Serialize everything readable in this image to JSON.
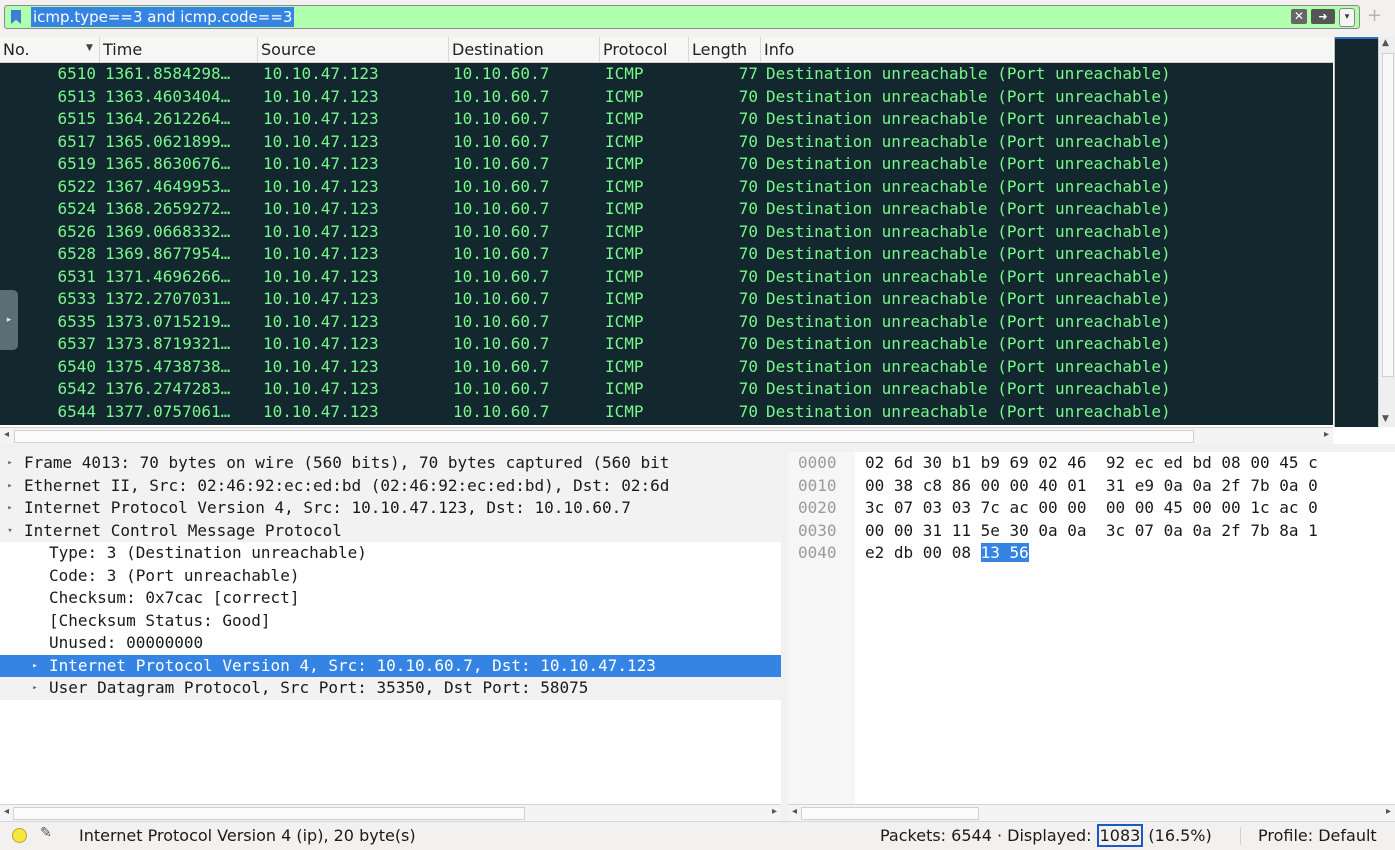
{
  "filter": {
    "expression": "icmp.type==3 and icmp.code==3",
    "clear_icon": "clear-icon",
    "apply_icon": "apply-arrow-icon",
    "plus": "+"
  },
  "packet_list": {
    "columns": [
      "No.",
      "Time",
      "Source",
      "Destination",
      "Protocol",
      "Length",
      "Info"
    ],
    "rows": [
      {
        "no": "6510",
        "time": "1361.8584298…",
        "src": "10.10.47.123",
        "dst": "10.10.60.7",
        "proto": "ICMP",
        "len": "77",
        "info": "Destination unreachable (Port unreachable)"
      },
      {
        "no": "6513",
        "time": "1363.4603404…",
        "src": "10.10.47.123",
        "dst": "10.10.60.7",
        "proto": "ICMP",
        "len": "70",
        "info": "Destination unreachable (Port unreachable)"
      },
      {
        "no": "6515",
        "time": "1364.2612264…",
        "src": "10.10.47.123",
        "dst": "10.10.60.7",
        "proto": "ICMP",
        "len": "70",
        "info": "Destination unreachable (Port unreachable)"
      },
      {
        "no": "6517",
        "time": "1365.0621899…",
        "src": "10.10.47.123",
        "dst": "10.10.60.7",
        "proto": "ICMP",
        "len": "70",
        "info": "Destination unreachable (Port unreachable)"
      },
      {
        "no": "6519",
        "time": "1365.8630676…",
        "src": "10.10.47.123",
        "dst": "10.10.60.7",
        "proto": "ICMP",
        "len": "70",
        "info": "Destination unreachable (Port unreachable)"
      },
      {
        "no": "6522",
        "time": "1367.4649953…",
        "src": "10.10.47.123",
        "dst": "10.10.60.7",
        "proto": "ICMP",
        "len": "70",
        "info": "Destination unreachable (Port unreachable)"
      },
      {
        "no": "6524",
        "time": "1368.2659272…",
        "src": "10.10.47.123",
        "dst": "10.10.60.7",
        "proto": "ICMP",
        "len": "70",
        "info": "Destination unreachable (Port unreachable)"
      },
      {
        "no": "6526",
        "time": "1369.0668332…",
        "src": "10.10.47.123",
        "dst": "10.10.60.7",
        "proto": "ICMP",
        "len": "70",
        "info": "Destination unreachable (Port unreachable)"
      },
      {
        "no": "6528",
        "time": "1369.8677954…",
        "src": "10.10.47.123",
        "dst": "10.10.60.7",
        "proto": "ICMP",
        "len": "70",
        "info": "Destination unreachable (Port unreachable)"
      },
      {
        "no": "6531",
        "time": "1371.4696266…",
        "src": "10.10.47.123",
        "dst": "10.10.60.7",
        "proto": "ICMP",
        "len": "70",
        "info": "Destination unreachable (Port unreachable)"
      },
      {
        "no": "6533",
        "time": "1372.2707031…",
        "src": "10.10.47.123",
        "dst": "10.10.60.7",
        "proto": "ICMP",
        "len": "70",
        "info": "Destination unreachable (Port unreachable)"
      },
      {
        "no": "6535",
        "time": "1373.0715219…",
        "src": "10.10.47.123",
        "dst": "10.10.60.7",
        "proto": "ICMP",
        "len": "70",
        "info": "Destination unreachable (Port unreachable)"
      },
      {
        "no": "6537",
        "time": "1373.8719321…",
        "src": "10.10.47.123",
        "dst": "10.10.60.7",
        "proto": "ICMP",
        "len": "70",
        "info": "Destination unreachable (Port unreachable)"
      },
      {
        "no": "6540",
        "time": "1375.4738738…",
        "src": "10.10.47.123",
        "dst": "10.10.60.7",
        "proto": "ICMP",
        "len": "70",
        "info": "Destination unreachable (Port unreachable)"
      },
      {
        "no": "6542",
        "time": "1376.2747283…",
        "src": "10.10.47.123",
        "dst": "10.10.60.7",
        "proto": "ICMP",
        "len": "70",
        "info": "Destination unreachable (Port unreachable)"
      },
      {
        "no": "6544",
        "time": "1377.0757061…",
        "src": "10.10.47.123",
        "dst": "10.10.60.7",
        "proto": "ICMP",
        "len": "70",
        "info": "Destination unreachable (Port unreachable)"
      }
    ],
    "row_bg": "#12272e",
    "row_fg": "#78f78b"
  },
  "details": [
    {
      "text": "Frame 4013: 70 bytes on wire (560 bits), 70 bytes captured (560 bit",
      "toggle": "▸",
      "indent": 0,
      "shaded": true,
      "selected": false
    },
    {
      "text": "Ethernet II, Src: 02:46:92:ec:ed:bd (02:46:92:ec:ed:bd), Dst: 02:6d",
      "toggle": "▸",
      "indent": 0,
      "shaded": true,
      "selected": false
    },
    {
      "text": "Internet Protocol Version 4, Src: 10.10.47.123, Dst: 10.10.60.7",
      "toggle": "▸",
      "indent": 0,
      "shaded": true,
      "selected": false
    },
    {
      "text": "Internet Control Message Protocol",
      "toggle": "▾",
      "indent": 0,
      "shaded": true,
      "selected": false
    },
    {
      "text": "Type: 3 (Destination unreachable)",
      "toggle": "",
      "indent": 1,
      "shaded": false,
      "selected": false
    },
    {
      "text": "Code: 3 (Port unreachable)",
      "toggle": "",
      "indent": 1,
      "shaded": false,
      "selected": false
    },
    {
      "text": "Checksum: 0x7cac [correct]",
      "toggle": "",
      "indent": 1,
      "shaded": false,
      "selected": false
    },
    {
      "text": "[Checksum Status: Good]",
      "toggle": "",
      "indent": 1,
      "shaded": false,
      "selected": false
    },
    {
      "text": "Unused: 00000000",
      "toggle": "",
      "indent": 1,
      "shaded": false,
      "selected": false
    },
    {
      "text": "Internet Protocol Version 4, Src: 10.10.60.7, Dst: 10.10.47.123",
      "toggle": "▸",
      "indent": 1,
      "shaded": false,
      "selected": true
    },
    {
      "text": "User Datagram Protocol, Src Port: 35350, Dst Port: 58075",
      "toggle": "▸",
      "indent": 1,
      "shaded": true,
      "selected": false
    }
  ],
  "bytes": [
    {
      "off": "0000",
      "hex": "02 6d 30 b1 b9 69 02 46  92 ec ed bd 08 00 45 c"
    },
    {
      "off": "0010",
      "hex": "00 38 c8 86 00 00 40 01  31 e9 0a 0a 2f 7b 0a 0"
    },
    {
      "off": "0020",
      "hex": "3c 07 03 03 7c ac 00 00  00 00 45 00 00 1c ac 0"
    },
    {
      "off": "0030",
      "hex": "00 00 31 11 5e 30 0a 0a  3c 07 0a 0a 2f 7b 8a 1"
    },
    {
      "off": "0040",
      "hex_plain": "e2 db 00 08 ",
      "hex_highlight": "13 56"
    }
  ],
  "status": {
    "expert_icon": "expert-info-icon",
    "edit_icon": "edit-comment-icon",
    "field_text": "Internet Protocol Version 4 (ip), 20 byte(s)",
    "packets_prefix": "Packets: 6544 · Displayed: ",
    "displayed": "1083",
    "displayed_pct": " (16.5%)",
    "profile": "Profile: Default"
  }
}
